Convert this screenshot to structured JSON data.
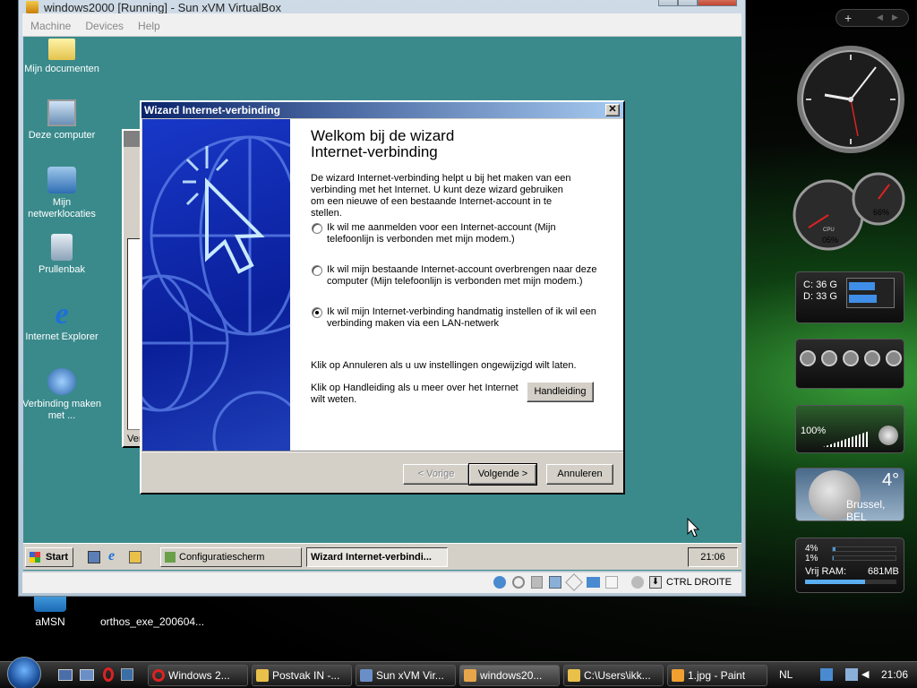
{
  "vbox": {
    "title": "windows2000 [Running] - Sun xVM VirtualBox",
    "menu": [
      "Machine",
      "Devices",
      "Help"
    ],
    "host_key": "CTRL DROITE"
  },
  "guest_desktop": {
    "icons": [
      {
        "label": "Mijn documenten"
      },
      {
        "label": "Deze computer"
      },
      {
        "label": "Mijn netwerklocaties"
      },
      {
        "label": "Prullenbak"
      },
      {
        "label": "Internet Explorer"
      },
      {
        "label": "Verbinding maken met ..."
      }
    ]
  },
  "wizard": {
    "title": "Wizard Internet-verbinding",
    "heading": "Welkom bij de wizard Internet-verbinding",
    "intro": "De wizard Internet-verbinding helpt u bij het maken van een verbinding met het Internet. U kunt deze wizard gebruiken om een nieuwe of een bestaande Internet-account in te stellen.",
    "options": [
      {
        "label": "Ik wil me aanmelden voor een Internet-account (Mijn telefoonlijn is verbonden met mijn modem.)",
        "selected": false
      },
      {
        "label": "Ik wil mijn bestaande Internet-account overbrengen naar deze computer (Mijn telefoonlijn is verbonden met mijn modem.)",
        "selected": false
      },
      {
        "label": "Ik wil mijn Internet-verbinding handmatig instellen of ik wil een verbinding maken via een LAN-netwerk",
        "selected": true
      }
    ],
    "cancel_note": "Klik op Annuleren als u uw instellingen ongewijzigd wilt laten.",
    "manual_note": "Klik op Handleiding als u meer over het Internet wilt weten.",
    "manual_button": "Handleiding",
    "back_button": "< Vorige",
    "next_button": "Volgende >",
    "cancel_button": "Annuleren"
  },
  "behind_window": {
    "status_fragment": "Ver"
  },
  "guest_taskbar": {
    "start": "Start",
    "tasks": [
      "Configuratiescherm",
      "Wizard Internet-verbindi..."
    ],
    "clock": "21:06"
  },
  "host_desktop": {
    "icons": [
      {
        "label": "aMSN"
      },
      {
        "label": "orthos_exe_200604..."
      }
    ]
  },
  "gadgets": {
    "cpu_label": "CPU",
    "cpu_value": "05%",
    "mem_value": "66%",
    "drives": [
      {
        "label": "C:",
        "value": "36 G",
        "fill": 0.55
      },
      {
        "label": "D:",
        "value": "33 G",
        "fill": 0.6
      }
    ],
    "volume": "100%",
    "weather_temp": "4°",
    "weather_city": "Brussel, BEL",
    "cpu1": "4%",
    "cpu2": "1%",
    "ram_label": "Vrij RAM:",
    "ram_value": "681MB",
    "ram_fill": 0.66
  },
  "host_taskbar": {
    "tasks": [
      "Windows 2...",
      "Postvak IN -...",
      "Sun xVM Vir...",
      "windows20...",
      "C:\\Users\\ikk...",
      "1.jpg - Paint"
    ],
    "lang": "NL",
    "clock": "21:06"
  }
}
